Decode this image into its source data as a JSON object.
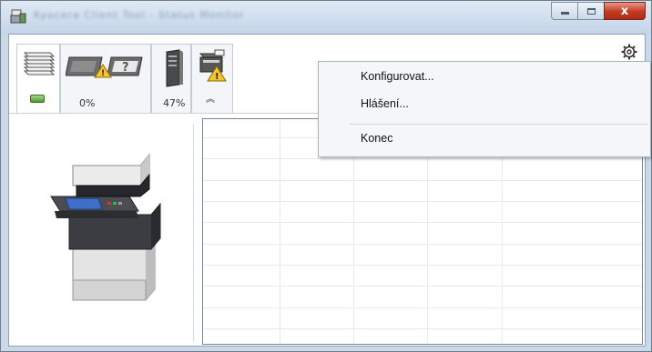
{
  "window": {
    "title_text": "Kyocera Client Tool - Status Monitor",
    "caption_buttons": {
      "minimize": "minimize",
      "maximize": "maximize",
      "close": "x"
    }
  },
  "toolbar": {
    "tabs": [
      {
        "icon": "printer-status-icon",
        "label": ""
      },
      {
        "icon": "toner-warning-icon",
        "label": "0%"
      },
      {
        "icon": "paper-level-icon",
        "label": "47%"
      },
      {
        "icon": "tray-warning-icon",
        "label": ""
      }
    ],
    "collapse_arrow": "︽",
    "gear_icon": "gear-icon"
  },
  "context_menu": {
    "items": [
      {
        "label": "Konfigurovat..."
      },
      {
        "label": "Hlášení..."
      },
      {
        "label": "Konec"
      }
    ]
  },
  "colors": {
    "window_frame": "#c9d9ea",
    "close_button": "#c23a22",
    "menu_background": "#f4f6f8"
  }
}
